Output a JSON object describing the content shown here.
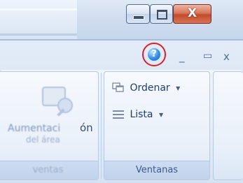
{
  "window": {
    "caption_buttons": {
      "minimize_icon": "minimize-icon",
      "maximize_icon": "maximize-icon",
      "close_glyph": "X"
    }
  },
  "mdi_controls": {
    "help_glyph": "?",
    "minimize_glyph": "_",
    "restore_glyph": "▭",
    "close_glyph": "x"
  },
  "ribbon": {
    "zoom_group": {
      "button_label_line1": "Aumentación",
      "button_label_line2": "del área",
      "footer_label": "ventas"
    },
    "window_group": {
      "arrange_label": "Ordenar",
      "list_label": "Lista",
      "footer_label": "Ventanas"
    }
  },
  "colors": {
    "accent_ring": "#d9212a",
    "ribbon_text": "#1e3e6e",
    "group_footer_text": "#3d5a8a"
  }
}
